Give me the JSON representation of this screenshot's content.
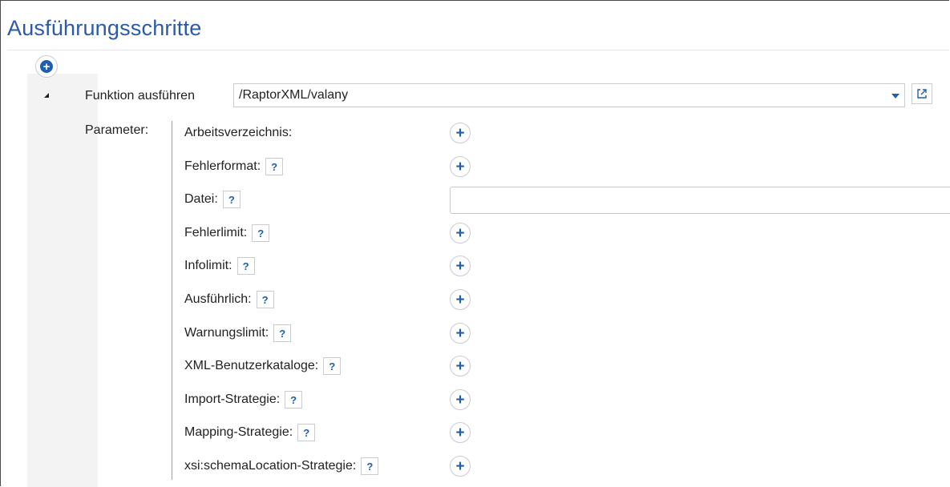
{
  "page": {
    "title": "Ausführungsschritte"
  },
  "step": {
    "function_label": "Funktion ausführen",
    "function_value": "/RaptorXML/valany",
    "parameters_label": "Parameter:"
  },
  "parameters": [
    {
      "label": "Arbeitsverzeichnis:",
      "has_help": false,
      "control": "plus"
    },
    {
      "label": "Fehlerformat:",
      "has_help": true,
      "control": "plus"
    },
    {
      "label": "Datei:",
      "has_help": true,
      "control": "input",
      "value": ""
    },
    {
      "label": "Fehlerlimit:",
      "has_help": true,
      "control": "plus"
    },
    {
      "label": "Infolimit:",
      "has_help": true,
      "control": "plus"
    },
    {
      "label": "Ausführlich:",
      "has_help": true,
      "control": "plus"
    },
    {
      "label": "Warnungslimit:",
      "has_help": true,
      "control": "plus"
    },
    {
      "label": "XML-Benutzerkataloge:",
      "has_help": true,
      "control": "plus"
    },
    {
      "label": "Import-Strategie:",
      "has_help": true,
      "control": "plus"
    },
    {
      "label": "Mapping-Strategie:",
      "has_help": true,
      "control": "plus"
    },
    {
      "label": "xsi:schemaLocation-Strategie:",
      "has_help": true,
      "control": "plus"
    }
  ],
  "ui": {
    "help_glyph": "?",
    "plus_glyph": "+",
    "accent_color": "#1e5fb4",
    "title_color": "#2b5aa8"
  }
}
